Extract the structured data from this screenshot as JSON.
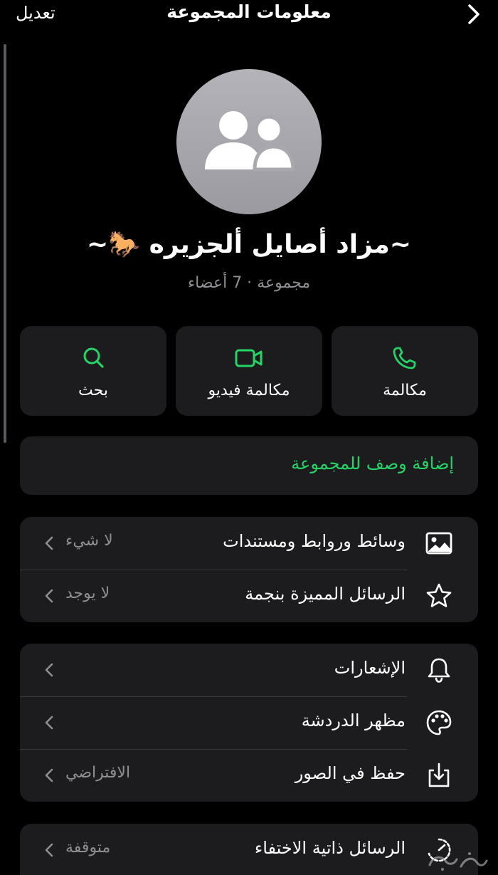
{
  "header": {
    "edit_label": "تعديل",
    "title": "معلومات المجموعة"
  },
  "group": {
    "name": "~مزاد أصايل ألجزيره 🐎~",
    "subtitle": "مجموعة · 7 أعضاء"
  },
  "actions": [
    {
      "label": "بحث",
      "icon": "search-icon"
    },
    {
      "label": "مكالمة فيديو",
      "icon": "video-camera-icon"
    },
    {
      "label": "مكالمة",
      "icon": "phone-icon"
    }
  ],
  "description": {
    "add_label": "إضافة وصف للمجموعة"
  },
  "section1": [
    {
      "label": "وسائط وروابط ومستندات",
      "value": "لا شيء",
      "icon": "image-icon"
    },
    {
      "label": "الرسائل المميزة بنجمة",
      "value": "لا يوجد",
      "icon": "star-icon"
    }
  ],
  "section2": [
    {
      "label": "الإشعارات",
      "value": "",
      "icon": "bell-icon"
    },
    {
      "label": "مظهر الدردشة",
      "value": "",
      "icon": "palette-icon"
    },
    {
      "label": "حفظ في الصور",
      "value": "الافتراضي",
      "icon": "save-download-icon"
    }
  ],
  "section3": [
    {
      "label": "الرسائل ذاتية الاختفاء",
      "value": "متوقفة",
      "icon": "timer-icon"
    }
  ],
  "colors": {
    "accent": "#25d366",
    "background": "#000000",
    "card": "#1c1c1e",
    "secondary_text": "#8e8e93"
  }
}
